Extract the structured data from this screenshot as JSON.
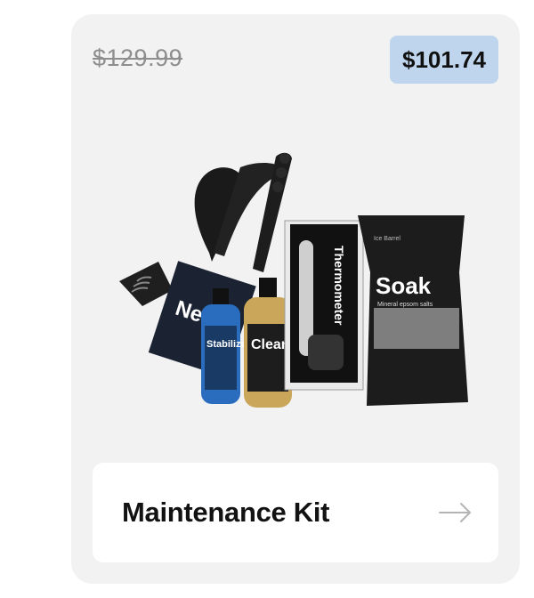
{
  "product": {
    "original_price": "$129.99",
    "sale_price": "$101.74",
    "name": "Maintenance Kit",
    "image_labels": {
      "net": "Net",
      "stabilize": "Stabilize",
      "clean": "Clean",
      "thermometer": "Thermometer",
      "soak": "Soak",
      "soak_subtitle": "Mineral epsom salts",
      "brand": "Ice Barrel"
    },
    "arrow_icon": "arrow-right-icon"
  },
  "colors": {
    "card_background": "#f2f2f2",
    "badge_background": "#bfd5ee",
    "original_price": "#8e8e8e",
    "name_text": "#121212"
  }
}
